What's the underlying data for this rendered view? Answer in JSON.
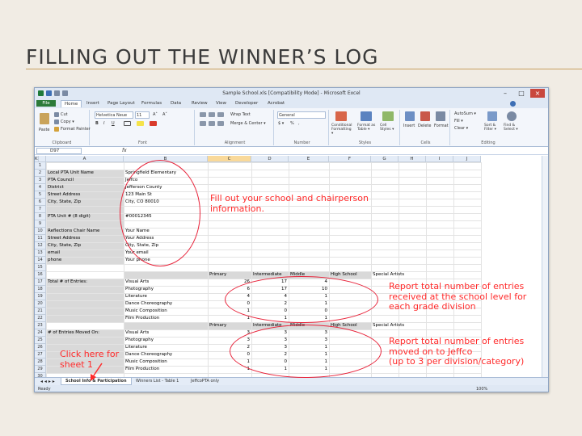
{
  "slide": {
    "title": "FILLING OUT THE WINNER’S LOG"
  },
  "window": {
    "title": "Sample School.xls  [Compatibility Mode]  -  Microsoft Excel"
  },
  "tabs": [
    "File",
    "Home",
    "Insert",
    "Page Layout",
    "Formulas",
    "Data",
    "Review",
    "View",
    "Developer",
    "Acrobat"
  ],
  "ribbon": {
    "clipboard": {
      "label": "Clipboard",
      "paste": "Paste",
      "cut": "Cut",
      "copy": "Copy ▾",
      "format_painter": "Format Painter"
    },
    "font": {
      "label": "Font",
      "name": "Helvetica Neue",
      "size": "11",
      "grow": "A˄",
      "shrink": "A˅",
      "bold": "B",
      "italic": "I",
      "underline": "U"
    },
    "alignment": {
      "label": "Alignment",
      "wrap": "Wrap Text",
      "merge": "Merge & Center ▾"
    },
    "number": {
      "label": "Number",
      "format": "General",
      "currency": "$ ▾",
      "percent": "%",
      "comma": ","
    },
    "styles": {
      "label": "Styles",
      "conditional": "Conditional Formatting ▾",
      "as_table": "Format as Table ▾",
      "cell_styles": "Cell Styles ▾"
    },
    "cells": {
      "label": "Cells",
      "insert": "Insert",
      "delete": "Delete",
      "format": "Format"
    },
    "editing": {
      "label": "Editing",
      "autosum": "AutoSum ▾",
      "fill": "Fill ▾",
      "clear": "Clear ▾",
      "sort": "Sort & Filter ▾",
      "find": "Find & Select ▾"
    }
  },
  "formula_bar": {
    "name_box": "D97",
    "fx": "fx"
  },
  "columns": [
    "A",
    "B",
    "C",
    "D",
    "E",
    "F",
    "G",
    "H",
    "I",
    "J",
    "K"
  ],
  "rows": [
    "1",
    "2",
    "3",
    "4",
    "5",
    "6",
    "7",
    "8",
    "9",
    "10",
    "11",
    "12",
    "13",
    "14",
    "15",
    "16",
    "17",
    "18",
    "19",
    "20",
    "21",
    "22",
    "23",
    "24",
    "25",
    "26",
    "27",
    "28",
    "29",
    "30"
  ],
  "info": [
    {
      "label": "Local PTA Unit Name",
      "value": "Springfield Elementary"
    },
    {
      "label": "PTA Council",
      "value": "Jeffco"
    },
    {
      "label": "District",
      "value": "Jefferson County"
    },
    {
      "label": "Street Address",
      "value": "123 Main St"
    },
    {
      "label": "City, State, Zip",
      "value": "City, CO 80010"
    },
    {
      "label": "",
      "value": ""
    },
    {
      "label": "PTA Unit # (8 digit)",
      "value": "#00012345"
    },
    {
      "label": "",
      "value": ""
    },
    {
      "label": "Reflections Chair Name",
      "value": "Your Name"
    },
    {
      "label": "Street Address",
      "value": "Your Address"
    },
    {
      "label": "City, State, Zip",
      "value": "City, State, Zip"
    },
    {
      "label": "email",
      "value": "Your email"
    },
    {
      "label": "phone",
      "value": "Your phone"
    }
  ],
  "levels": [
    "Primary",
    "Intermediate",
    "Middle",
    "High School",
    "Special Artists"
  ],
  "categories": [
    "Visual Arts",
    "Photography",
    "Literature",
    "Dance Choreography",
    "Music Composition",
    "Film Production"
  ],
  "total_label": "Total # of Entries:",
  "totals": [
    [
      "26",
      "17",
      "4"
    ],
    [
      "6",
      "17",
      "10"
    ],
    [
      "4",
      "4",
      "1"
    ],
    [
      "0",
      "2",
      "1"
    ],
    [
      "1",
      "0",
      "0"
    ],
    [
      "1",
      "1",
      "1"
    ]
  ],
  "moved_label": "# of Entries Moved On:",
  "moved": [
    [
      "3",
      "3",
      "3"
    ],
    [
      "3",
      "3",
      "3"
    ],
    [
      "2",
      "3",
      "1"
    ],
    [
      "0",
      "2",
      "1"
    ],
    [
      "1",
      "0",
      "1"
    ],
    [
      "1",
      "1",
      "1"
    ]
  ],
  "sheets": [
    "School Info & Participation",
    "Winners List - Table 1",
    "JeffcoPTA only"
  ],
  "status": {
    "ready": "Ready",
    "zoom": "100%"
  },
  "notes": {
    "school": [
      "Fill out your school and chairperson",
      "information."
    ],
    "total": [
      "Report total number of entries",
      "received at the school level for",
      "each grade division"
    ],
    "moved": [
      "Report total number of entries",
      "moved on to Jeffco",
      "(up to 3 per division/category)"
    ],
    "sheet": [
      "Click here for",
      "sheet 1"
    ]
  }
}
